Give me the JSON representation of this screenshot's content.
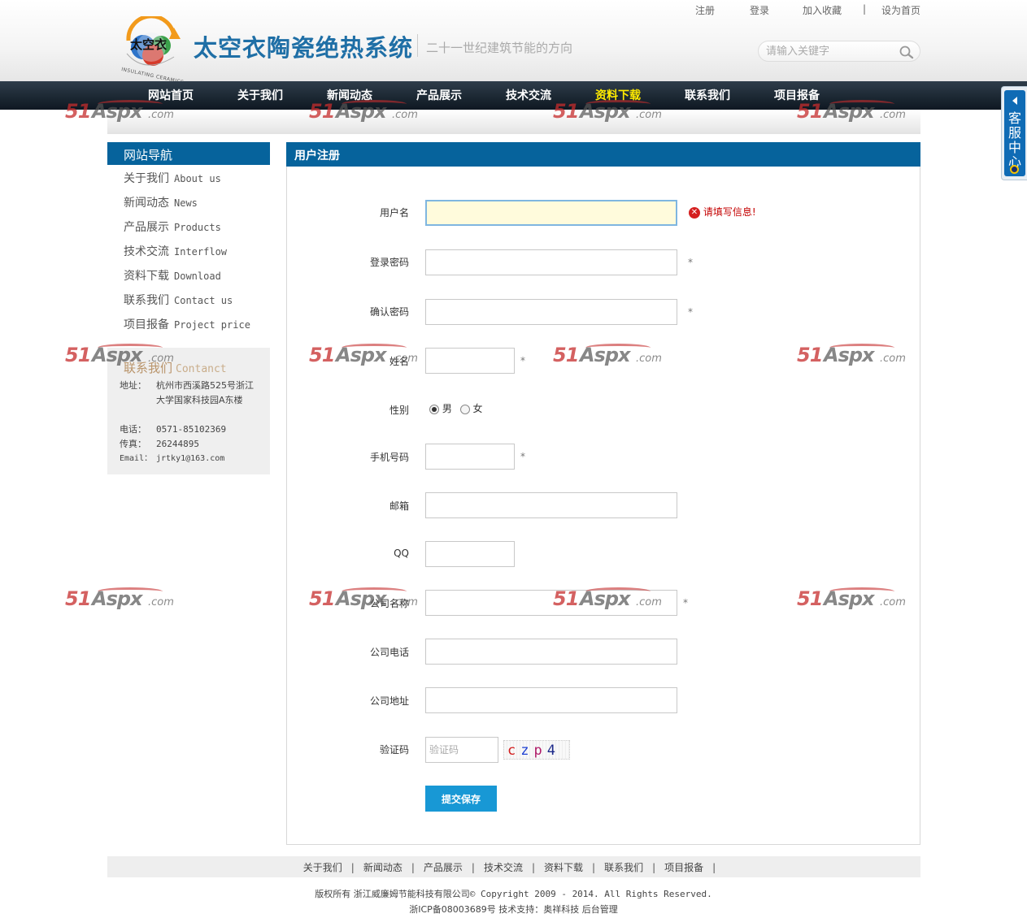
{
  "top_links": {
    "register": "注册",
    "login": "登录",
    "favorite": "加入收藏",
    "divider": "|",
    "homepage": "设为首页"
  },
  "site": {
    "title": "太空衣陶瓷绝热系统",
    "slogan": "二十一世纪建筑节能的方向",
    "logo_text": "太空衣",
    "logo_ring_text": "INSULATING CERAMICS"
  },
  "search": {
    "placeholder": "请输入关键字",
    "icon": "search-icon"
  },
  "nav": {
    "items": [
      {
        "label": "网站首页",
        "active": false
      },
      {
        "label": "关于我们",
        "active": false
      },
      {
        "label": "新闻动态",
        "active": false
      },
      {
        "label": "产品展示",
        "active": false
      },
      {
        "label": "技术交流",
        "active": false
      },
      {
        "label": "资料下载",
        "active": true
      },
      {
        "label": "联系我们",
        "active": false
      },
      {
        "label": "项目报备",
        "active": false
      }
    ]
  },
  "service_tab": {
    "label": "客服中心"
  },
  "sidebar": {
    "title": "网站导航",
    "items": [
      {
        "zh": "关于我们",
        "en": "About us"
      },
      {
        "zh": "新闻动态",
        "en": "News"
      },
      {
        "zh": "产品展示",
        "en": "Products"
      },
      {
        "zh": "技术交流",
        "en": "Interflow"
      },
      {
        "zh": "资料下载",
        "en": "Download"
      },
      {
        "zh": "联系我们",
        "en": "Contact us"
      },
      {
        "zh": "项目报备",
        "en": "Project price"
      }
    ],
    "contact": {
      "title_zh": "联系我们",
      "title_en": "Contanct",
      "address_label": "地址：",
      "address": "杭州市西溪路525号浙江大学国家科技园A东楼",
      "phone_label": "电话：",
      "phone": "0571-85102369",
      "fax_label": "传真：",
      "fax": "26244895",
      "email_label": "Email：",
      "email": "jrtky1@163.com"
    }
  },
  "form": {
    "title": "用户注册",
    "required_mark": "*",
    "error_message": "请填写信息!",
    "fields": {
      "username": {
        "label": "用户名",
        "value": ""
      },
      "password": {
        "label": "登录密码",
        "value": ""
      },
      "confirm_password": {
        "label": "确认密码",
        "value": ""
      },
      "name": {
        "label": "姓名",
        "value": ""
      },
      "gender": {
        "label": "性别",
        "options": [
          "男",
          "女"
        ],
        "selected": "男"
      },
      "mobile": {
        "label": "手机号码",
        "value": ""
      },
      "email": {
        "label": "邮箱",
        "value": ""
      },
      "qq": {
        "label": "QQ",
        "value": ""
      },
      "company_name": {
        "label": "公司名称",
        "value": ""
      },
      "company_phone": {
        "label": "公司电话",
        "value": ""
      },
      "company_address": {
        "label": "公司地址",
        "value": ""
      },
      "captcha": {
        "label": "验证码",
        "placeholder": "验证码",
        "image_text": [
          "c",
          "z",
          "p",
          "4"
        ]
      }
    },
    "submit_label": "提交保存"
  },
  "footer": {
    "links": [
      "关于我们",
      "新闻动态",
      "产品展示",
      "技术交流",
      "资料下载",
      "联系我们",
      "项目报备"
    ],
    "separator": "|",
    "copyright_prefix": "版权所有 浙江威廉姆节能科技有限公司",
    "copyright_suffix": "© Copyright 2009 - 2014. All Rights Reserved.",
    "icp": "浙ICP备08003689号 技术支持：奥祥科技 后台管理"
  },
  "watermark": {
    "part1": "51",
    "part2": "Aspx",
    "part3": ".com"
  },
  "colors": {
    "brand_blue": "#06639c",
    "nav_active": "#ffea00",
    "button_blue": "#1898d5",
    "error_red": "#c40000"
  }
}
